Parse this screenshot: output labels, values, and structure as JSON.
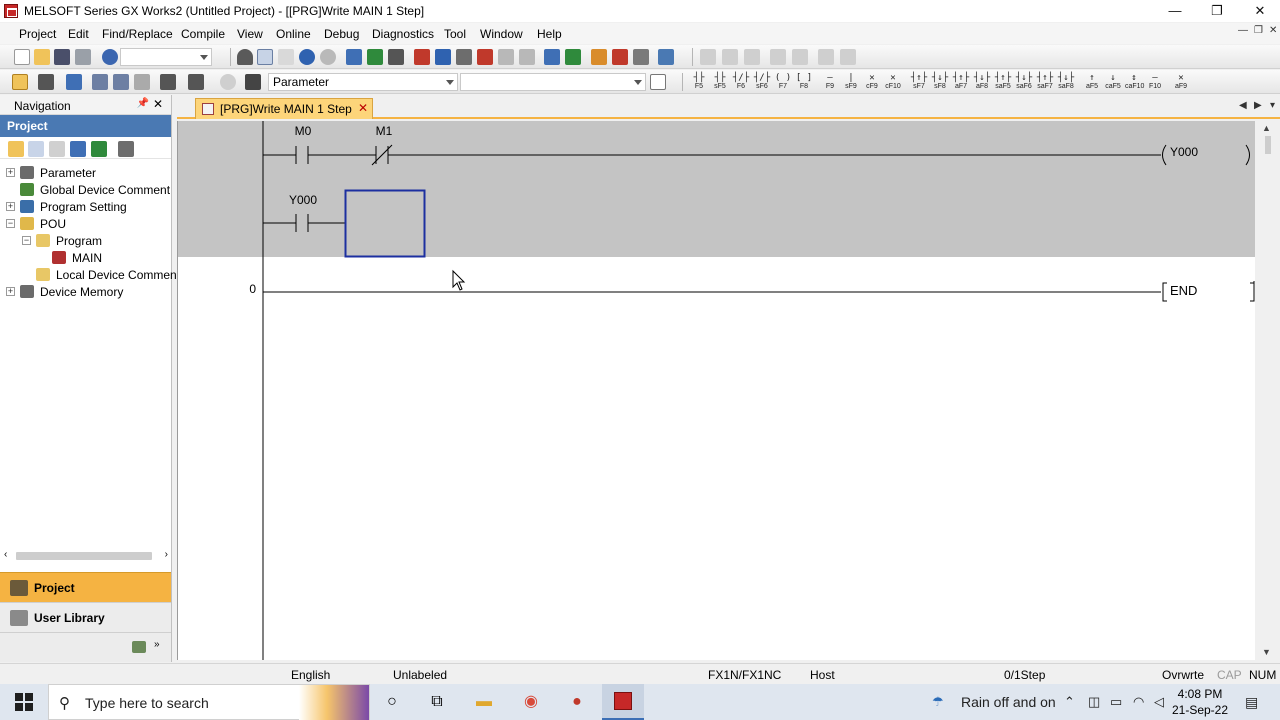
{
  "window": {
    "title": "MELSOFT Series GX Works2 (Untitled Project) - [[PRG]Write MAIN 1 Step]",
    "minimize_glyph": "—",
    "maximize_glyph": "❐",
    "close_glyph": "✕"
  },
  "menu": [
    {
      "label": "Project",
      "hotkey_index": 0
    },
    {
      "label": "Edit",
      "hotkey_index": 0
    },
    {
      "label": "Find/Replace",
      "hotkey_index": 0
    },
    {
      "label": "Compile",
      "hotkey_index": 0
    },
    {
      "label": "View",
      "hotkey_index": 0
    },
    {
      "label": "Online",
      "hotkey_index": 0
    },
    {
      "label": "Debug",
      "hotkey_index": 0
    },
    {
      "label": "Diagnostics",
      "hotkey_index": 0
    },
    {
      "label": "Tool",
      "hotkey_index": 0
    },
    {
      "label": "Window",
      "hotkey_index": 0
    },
    {
      "label": "Help",
      "hotkey_index": 0
    }
  ],
  "toolbar": {
    "parameter_combo_value": "Parameter",
    "fkeys": [
      {
        "sym": "┤├",
        "label": "F5"
      },
      {
        "sym": "┤├",
        "label": "sF5"
      },
      {
        "sym": "┤/├",
        "label": "F6"
      },
      {
        "sym": "┤/├",
        "label": "sF6"
      },
      {
        "sym": "( )",
        "label": "F7"
      },
      {
        "sym": "[ ]",
        "label": "F8"
      },
      {
        "sym": "—",
        "label": "F9"
      },
      {
        "sym": "|",
        "label": "sF9"
      },
      {
        "sym": "✕",
        "label": "cF9"
      },
      {
        "sym": "✕",
        "label": "cF10"
      },
      {
        "sym": "┤↑├",
        "label": "sF7"
      },
      {
        "sym": "┤↓├",
        "label": "sF8"
      },
      {
        "sym": "┤↑├",
        "label": "aF7"
      },
      {
        "sym": "┤↓├",
        "label": "aF8"
      },
      {
        "sym": "┤↑├",
        "label": "saF5"
      },
      {
        "sym": "┤↓├",
        "label": "saF6"
      },
      {
        "sym": "┤↑├",
        "label": "saF7"
      },
      {
        "sym": "┤↓├",
        "label": "saF8"
      },
      {
        "sym": "↑",
        "label": "aF5"
      },
      {
        "sym": "↓",
        "label": "caF5"
      },
      {
        "sym": "↕",
        "label": "caF10"
      },
      {
        "sym": "—",
        "label": "F10"
      },
      {
        "sym": "✕",
        "label": "aF9"
      }
    ]
  },
  "navigation": {
    "title": "Navigation",
    "section": "Project",
    "tree": [
      {
        "label": "Parameter",
        "level": 0,
        "expander": "+",
        "icon_color": "#6b6b6b"
      },
      {
        "label": "Global Device Comment",
        "level": 0,
        "expander": "",
        "icon_color": "#4a8a3a"
      },
      {
        "label": "Program Setting",
        "level": 0,
        "expander": "+",
        "icon_color": "#3a6ea8"
      },
      {
        "label": "POU",
        "level": 0,
        "expander": "−",
        "icon_color": "#e0b84a"
      },
      {
        "label": "Program",
        "level": 1,
        "expander": "−",
        "icon_color": "#e8c766"
      },
      {
        "label": "MAIN",
        "level": 2,
        "expander": "",
        "icon_color": "#b03030"
      },
      {
        "label": "Local Device Commen",
        "level": 1,
        "expander": "",
        "icon_color": "#e8c766"
      },
      {
        "label": "Device Memory",
        "level": 0,
        "expander": "+",
        "icon_color": "#6b6b6b"
      }
    ],
    "pane_buttons": [
      {
        "label": "Project",
        "active": true
      },
      {
        "label": "User Library",
        "active": false
      }
    ]
  },
  "editor": {
    "tab_label": "[PRG]Write MAIN 1 Step",
    "rungs": {
      "contact_labels": [
        "M0",
        "M1",
        "Y000"
      ],
      "coil_label": "Y000",
      "end_label": "END",
      "step_number": "0"
    }
  },
  "status": {
    "language": "English",
    "label": "Unlabeled",
    "plc_type": "FX1N/FX1NC",
    "connection": "Host",
    "steps": "0/1Step",
    "mode": "Ovrwrte",
    "cap": "CAP",
    "num": "NUM"
  },
  "taskbar": {
    "search_placeholder": "Type here to search",
    "weather": "Rain off and on",
    "time": "4:08 PM",
    "date": "21-Sep-22"
  },
  "colors": {
    "nav_project_header": "#4a79b3",
    "active_pane_button": "#f5b342",
    "tab_active": "#fdd57a",
    "edit_area_gray": "#c4c4c4",
    "cursor_box": "#1c2fa0"
  }
}
